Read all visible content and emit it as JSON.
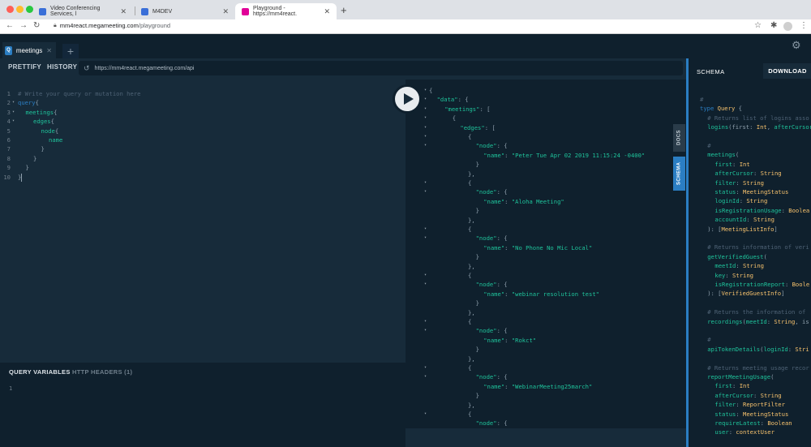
{
  "browser": {
    "tabs": [
      {
        "title": "Video Conferencing Services, l",
        "favicon_color": "#3a6fd8"
      },
      {
        "title": "M4DEV",
        "favicon_color": "#3a6fd8"
      },
      {
        "title": "Playground - https://mm4react.",
        "favicon_color": "#e10098"
      }
    ],
    "url_host": "mm4react.megameeting.com",
    "url_path": "/playground"
  },
  "playground": {
    "tab_label": "meetings",
    "tab_badge": "Q",
    "toolbar": {
      "prettify": "PRETTIFY",
      "history": "HISTORY",
      "endpoint": "https://mm4react.megameeting.com/api"
    },
    "query_lines": [
      {
        "n": "1",
        "fold": "",
        "indent": 0,
        "parts": [
          {
            "t": "# Write your query or mutation here",
            "c": "c-comment"
          }
        ]
      },
      {
        "n": "2",
        "fold": "▾",
        "indent": 0,
        "parts": [
          {
            "t": "query",
            "c": "c-kw"
          },
          {
            "t": "{",
            "c": "c-punct"
          }
        ]
      },
      {
        "n": "3",
        "fold": "▾",
        "indent": 1,
        "parts": [
          {
            "t": "meetings",
            "c": "c-field"
          },
          {
            "t": "{",
            "c": "c-punct"
          }
        ]
      },
      {
        "n": "4",
        "fold": "▾",
        "indent": 2,
        "parts": [
          {
            "t": "edges",
            "c": "c-field"
          },
          {
            "t": "{",
            "c": "c-punct"
          }
        ]
      },
      {
        "n": "5",
        "fold": "",
        "indent": 3,
        "parts": [
          {
            "t": "node",
            "c": "c-field"
          },
          {
            "t": "{",
            "c": "c-punct"
          }
        ]
      },
      {
        "n": "6",
        "fold": "",
        "indent": 4,
        "parts": [
          {
            "t": "name",
            "c": "c-field"
          }
        ]
      },
      {
        "n": "7",
        "fold": "",
        "indent": 3,
        "parts": [
          {
            "t": "}",
            "c": "c-punct"
          }
        ]
      },
      {
        "n": "8",
        "fold": "",
        "indent": 2,
        "parts": [
          {
            "t": "}",
            "c": "c-punct"
          }
        ]
      },
      {
        "n": "9",
        "fold": "",
        "indent": 1,
        "parts": [
          {
            "t": "}",
            "c": "c-punct"
          }
        ]
      },
      {
        "n": "10",
        "fold": "",
        "indent": 0,
        "parts": [
          {
            "t": "}",
            "c": "c-punct"
          }
        ]
      }
    ],
    "query_variables_label": "QUERY VARIABLES",
    "http_headers_label": "HTTP HEADERS (1)",
    "variables_line_number": "1",
    "meeting_names": [
      "Peter Tue Apr 02 2019 11:15:24 -0400",
      "Aloha Meeting",
      "No Phone No Mic Local",
      "webinar resolution test",
      "Rokct",
      "WebinarMeeting25march"
    ],
    "docs_label": "DOCS",
    "schema_tab_label": "SCHEMA"
  },
  "schema": {
    "title": "SCHEMA",
    "download_label": "DOWNLOAD",
    "lines": [
      {
        "indent": 0,
        "parts": [
          {
            "t": "#",
            "c": "s-c"
          }
        ]
      },
      {
        "indent": 0,
        "parts": [
          {
            "t": "type ",
            "c": "s-kw"
          },
          {
            "t": "Query",
            "c": "s-type"
          },
          {
            "t": " {",
            "c": "s-p"
          }
        ]
      },
      {
        "indent": 1,
        "parts": [
          {
            "t": "# Returns list of logins asso",
            "c": "s-c"
          }
        ]
      },
      {
        "indent": 1,
        "parts": [
          {
            "t": "logins",
            "c": "s-field"
          },
          {
            "t": "(first: ",
            "c": "s-p"
          },
          {
            "t": "Int",
            "c": "s-type"
          },
          {
            "t": ", ",
            "c": "s-p"
          },
          {
            "t": "afterCursor",
            "c": "s-field"
          }
        ]
      },
      {
        "indent": 0,
        "parts": []
      },
      {
        "indent": 1,
        "parts": [
          {
            "t": "#",
            "c": "s-c"
          }
        ]
      },
      {
        "indent": 1,
        "parts": [
          {
            "t": "meetings",
            "c": "s-field"
          },
          {
            "t": "(",
            "c": "s-p"
          }
        ]
      },
      {
        "indent": 2,
        "parts": [
          {
            "t": "first",
            "c": "s-field"
          },
          {
            "t": ": ",
            "c": "s-p"
          },
          {
            "t": "Int",
            "c": "s-type"
          }
        ]
      },
      {
        "indent": 2,
        "parts": [
          {
            "t": "afterCursor",
            "c": "s-field"
          },
          {
            "t": ": ",
            "c": "s-p"
          },
          {
            "t": "String",
            "c": "s-type"
          }
        ]
      },
      {
        "indent": 2,
        "parts": [
          {
            "t": "filter",
            "c": "s-field"
          },
          {
            "t": ": ",
            "c": "s-p"
          },
          {
            "t": "String",
            "c": "s-type"
          }
        ]
      },
      {
        "indent": 2,
        "parts": [
          {
            "t": "status",
            "c": "s-field"
          },
          {
            "t": ": ",
            "c": "s-p"
          },
          {
            "t": "MeetingStatus",
            "c": "s-type"
          }
        ]
      },
      {
        "indent": 2,
        "parts": [
          {
            "t": "loginId",
            "c": "s-field"
          },
          {
            "t": ": ",
            "c": "s-p"
          },
          {
            "t": "String",
            "c": "s-type"
          }
        ]
      },
      {
        "indent": 2,
        "parts": [
          {
            "t": "isRegistrationUsage",
            "c": "s-field"
          },
          {
            "t": ": ",
            "c": "s-p"
          },
          {
            "t": "Boolea",
            "c": "s-type"
          }
        ]
      },
      {
        "indent": 2,
        "parts": [
          {
            "t": "accountId",
            "c": "s-field"
          },
          {
            "t": ": ",
            "c": "s-p"
          },
          {
            "t": "String",
            "c": "s-type"
          }
        ]
      },
      {
        "indent": 1,
        "parts": [
          {
            "t": "): [",
            "c": "s-p"
          },
          {
            "t": "MeetingListInfo",
            "c": "s-type"
          },
          {
            "t": "]",
            "c": "s-p"
          }
        ]
      },
      {
        "indent": 0,
        "parts": []
      },
      {
        "indent": 1,
        "parts": [
          {
            "t": "# Returns information of veri",
            "c": "s-c"
          }
        ]
      },
      {
        "indent": 1,
        "parts": [
          {
            "t": "getVerifiedGuest",
            "c": "s-field"
          },
          {
            "t": "(",
            "c": "s-p"
          }
        ]
      },
      {
        "indent": 2,
        "parts": [
          {
            "t": "meetId",
            "c": "s-field"
          },
          {
            "t": ": ",
            "c": "s-p"
          },
          {
            "t": "String",
            "c": "s-type"
          }
        ]
      },
      {
        "indent": 2,
        "parts": [
          {
            "t": "key",
            "c": "s-field"
          },
          {
            "t": ": ",
            "c": "s-p"
          },
          {
            "t": "String",
            "c": "s-type"
          }
        ]
      },
      {
        "indent": 2,
        "parts": [
          {
            "t": "isRegistrationReport",
            "c": "s-field"
          },
          {
            "t": ": ",
            "c": "s-p"
          },
          {
            "t": "Boole",
            "c": "s-type"
          }
        ]
      },
      {
        "indent": 1,
        "parts": [
          {
            "t": "): [",
            "c": "s-p"
          },
          {
            "t": "VerifiedGuestInfo",
            "c": "s-type"
          },
          {
            "t": "]",
            "c": "s-p"
          }
        ]
      },
      {
        "indent": 0,
        "parts": []
      },
      {
        "indent": 1,
        "parts": [
          {
            "t": "# Returns the information of",
            "c": "s-c"
          }
        ]
      },
      {
        "indent": 1,
        "parts": [
          {
            "t": "recordings",
            "c": "s-field"
          },
          {
            "t": "(",
            "c": "s-p"
          },
          {
            "t": "meetId",
            "c": "s-field"
          },
          {
            "t": ": ",
            "c": "s-p"
          },
          {
            "t": "String",
            "c": "s-type"
          },
          {
            "t": ", is",
            "c": "s-p"
          }
        ]
      },
      {
        "indent": 0,
        "parts": []
      },
      {
        "indent": 1,
        "parts": [
          {
            "t": "#",
            "c": "s-c"
          }
        ]
      },
      {
        "indent": 1,
        "parts": [
          {
            "t": "apiTokenDetails",
            "c": "s-field"
          },
          {
            "t": "(",
            "c": "s-p"
          },
          {
            "t": "loginId",
            "c": "s-field"
          },
          {
            "t": ": ",
            "c": "s-p"
          },
          {
            "t": "Stri",
            "c": "s-type"
          }
        ]
      },
      {
        "indent": 0,
        "parts": []
      },
      {
        "indent": 1,
        "parts": [
          {
            "t": "# Returns meeting usage recor",
            "c": "s-c"
          }
        ]
      },
      {
        "indent": 1,
        "parts": [
          {
            "t": "reportMeetingUsage",
            "c": "s-field"
          },
          {
            "t": "(",
            "c": "s-p"
          }
        ]
      },
      {
        "indent": 2,
        "parts": [
          {
            "t": "first",
            "c": "s-field"
          },
          {
            "t": ": ",
            "c": "s-p"
          },
          {
            "t": "Int",
            "c": "s-type"
          }
        ]
      },
      {
        "indent": 2,
        "parts": [
          {
            "t": "afterCursor",
            "c": "s-field"
          },
          {
            "t": ": ",
            "c": "s-p"
          },
          {
            "t": "String",
            "c": "s-type"
          }
        ]
      },
      {
        "indent": 2,
        "parts": [
          {
            "t": "filter",
            "c": "s-field"
          },
          {
            "t": ": ",
            "c": "s-p"
          },
          {
            "t": "ReportFilter",
            "c": "s-type"
          }
        ]
      },
      {
        "indent": 2,
        "parts": [
          {
            "t": "status",
            "c": "s-field"
          },
          {
            "t": ": ",
            "c": "s-p"
          },
          {
            "t": "MeetingStatus",
            "c": "s-type"
          }
        ]
      },
      {
        "indent": 2,
        "parts": [
          {
            "t": "requireLatest",
            "c": "s-field"
          },
          {
            "t": ": ",
            "c": "s-p"
          },
          {
            "t": "Boolean",
            "c": "s-type"
          }
        ]
      },
      {
        "indent": 2,
        "parts": [
          {
            "t": "user",
            "c": "s-field"
          },
          {
            "t": ": ",
            "c": "s-p"
          },
          {
            "t": "contextUser",
            "c": "s-type"
          }
        ]
      }
    ]
  }
}
